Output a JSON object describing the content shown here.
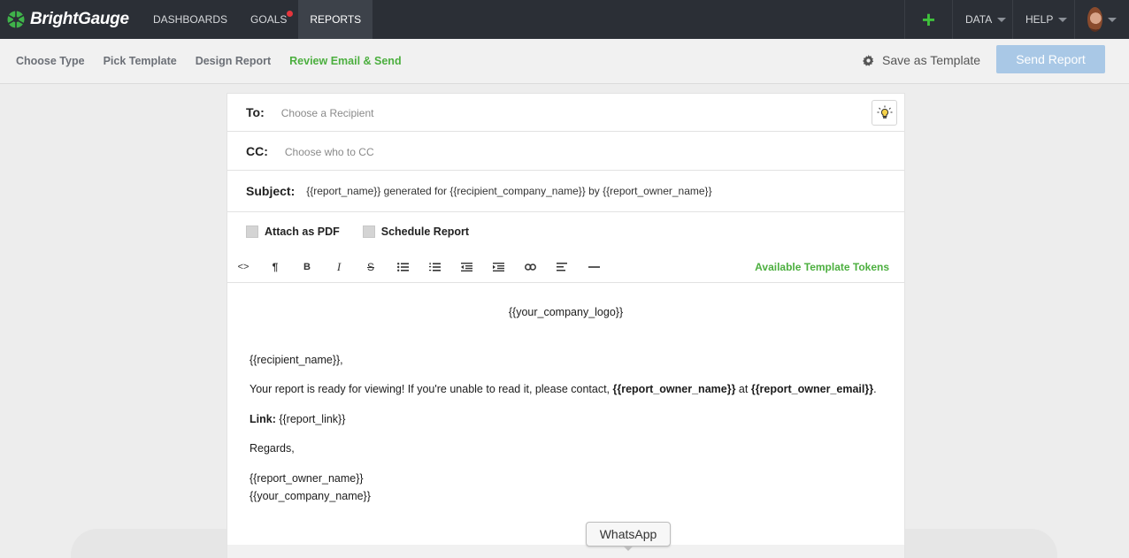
{
  "brand": {
    "name": "BrightGauge",
    "accent": "#4caf3f"
  },
  "nav": {
    "items": [
      {
        "label": "DASHBOARDS"
      },
      {
        "label": "GOALS",
        "has_notification": true
      },
      {
        "label": "REPORTS",
        "active": true
      }
    ],
    "right": {
      "add_icon": "plus-icon",
      "data_label": "DATA",
      "help_label": "HELP"
    }
  },
  "steps": {
    "items": [
      {
        "label": "Choose Type"
      },
      {
        "label": "Pick Template"
      },
      {
        "label": "Design Report"
      },
      {
        "label": "Review Email & Send",
        "active": true
      }
    ],
    "save_template_label": "Save as Template",
    "send_label": "Send Report"
  },
  "email": {
    "to_label": "To:",
    "to_placeholder": "Choose a Recipient",
    "cc_label": "CC:",
    "cc_placeholder": "Choose who to CC",
    "subject_label": "Subject:",
    "subject_value": "{{report_name}} generated for {{recipient_company_name}} by {{report_owner_name}}",
    "attach_pdf_label": "Attach as PDF",
    "schedule_label": "Schedule Report",
    "tokens_link": "Available Template Tokens",
    "toolbar_icons": [
      "code-icon",
      "paragraph-icon",
      "bold-icon",
      "italic-icon",
      "strikethrough-icon",
      "bullet-list-icon",
      "numbered-list-icon",
      "outdent-icon",
      "indent-icon",
      "link-icon",
      "align-left-icon",
      "horizontal-rule-icon"
    ]
  },
  "body": {
    "logo_token": "{{your_company_logo}}",
    "greeting": "{{recipient_name}},",
    "message_prefix": "Your report is ready for viewing! If you're unable to read it, please contact, ",
    "owner_name_token": "{{report_owner_name}}",
    "at_text": " at ",
    "owner_email_token": "{{report_owner_email}}",
    "period": ".",
    "link_label": "Link:",
    "link_token": " {{report_link}}",
    "regards": "Regards,",
    "sign_owner": "{{report_owner_name}}",
    "sign_company": "{{your_company_name}}"
  },
  "tooltip": {
    "label": "WhatsApp"
  }
}
